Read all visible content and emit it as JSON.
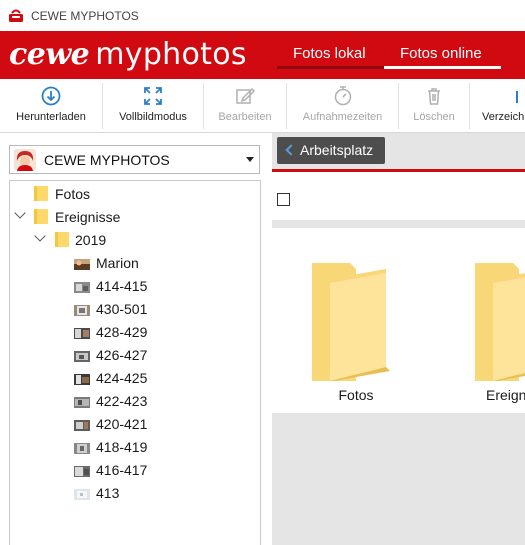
{
  "window": {
    "title": "CEWE MYPHOTOS"
  },
  "header": {
    "logo_cewe": "cewe",
    "logo_myphotos": "myphotos",
    "tabs": [
      {
        "label": "Fotos lokal",
        "active": false
      },
      {
        "label": "Fotos online",
        "active": true
      }
    ],
    "brand_color": "#d10a11"
  },
  "toolbar": {
    "items": [
      {
        "label": "Herunterladen",
        "icon": "download-icon",
        "enabled": true
      },
      {
        "label": "Vollbildmodus",
        "icon": "fullscreen-icon",
        "enabled": true
      },
      {
        "label": "Bearbeiten",
        "icon": "edit-icon",
        "enabled": false
      },
      {
        "label": "Aufnahmezeiten",
        "icon": "clock-icon",
        "enabled": false
      },
      {
        "label": "Löschen",
        "icon": "trash-icon",
        "enabled": false
      },
      {
        "label": "Verzeich",
        "icon": "folder-icon",
        "enabled": true
      }
    ]
  },
  "sidebar": {
    "account": {
      "label": "CEWE MYPHOTOS",
      "icon": "avatar-icon"
    },
    "tree": [
      {
        "label": "Fotos",
        "type": "folder",
        "expanded": false
      },
      {
        "label": "Ereignisse",
        "type": "folder",
        "expanded": true
      },
      {
        "label": "2019",
        "type": "folder",
        "expanded": true
      },
      {
        "label": "Marion",
        "type": "album"
      },
      {
        "label": "414-415",
        "type": "album"
      },
      {
        "label": "430-501",
        "type": "album"
      },
      {
        "label": "428-429",
        "type": "album"
      },
      {
        "label": "426-427",
        "type": "album"
      },
      {
        "label": "424-425",
        "type": "album"
      },
      {
        "label": "422-423",
        "type": "album"
      },
      {
        "label": "420-421",
        "type": "album"
      },
      {
        "label": "418-419",
        "type": "album"
      },
      {
        "label": "416-417",
        "type": "album"
      },
      {
        "label": "413",
        "type": "album"
      }
    ]
  },
  "main": {
    "back_button": "Arbeitsplatz",
    "tiles": [
      {
        "label": "Fotos",
        "icon": "folder-icon"
      },
      {
        "label": "Ereignisse",
        "icon": "folder-icon"
      }
    ]
  }
}
